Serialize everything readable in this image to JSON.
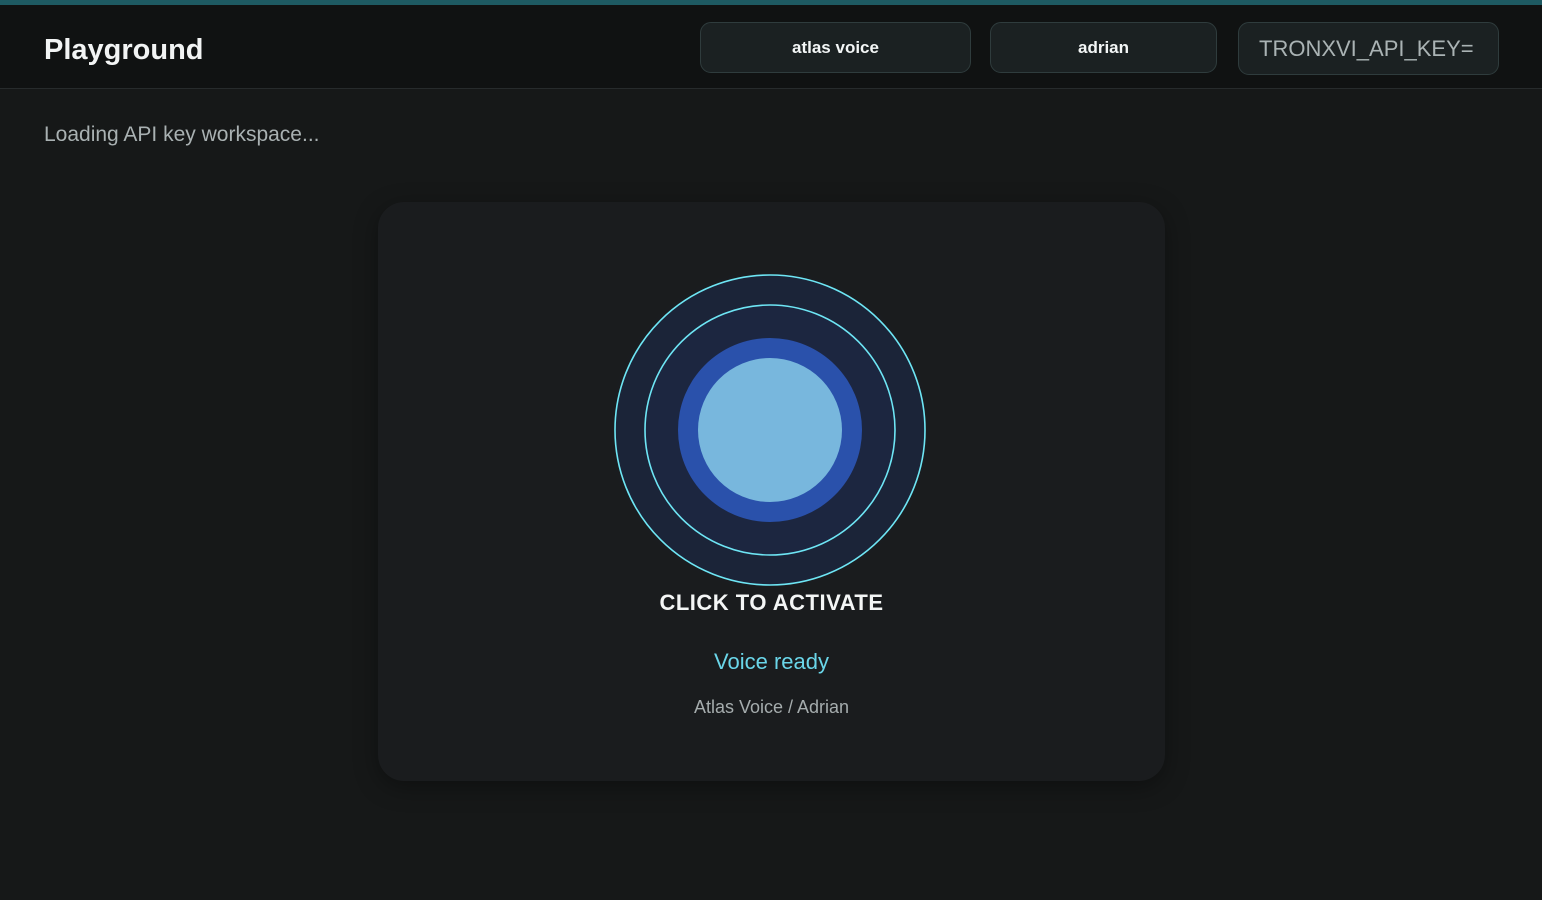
{
  "header": {
    "title": "Playground",
    "model_label": "atlas voice",
    "voice_label": "adrian",
    "api_key_value": "TRONXVI_API_KEY="
  },
  "main": {
    "loading_text": "Loading API key workspace..."
  },
  "voice_card": {
    "activate_label": "CLICK TO ACTIVATE",
    "status": "Voice ready",
    "voice_meta": "Atlas Voice / Adrian"
  },
  "colors": {
    "accent_bar": "#1e5a62",
    "ring_stroke": "#6ee6f5",
    "orb_inner": "#78b7dd",
    "orb_outer": "#2a51ab",
    "status_text": "#6ad6e9"
  },
  "icons": {
    "orb": "voice-orb-icon"
  }
}
